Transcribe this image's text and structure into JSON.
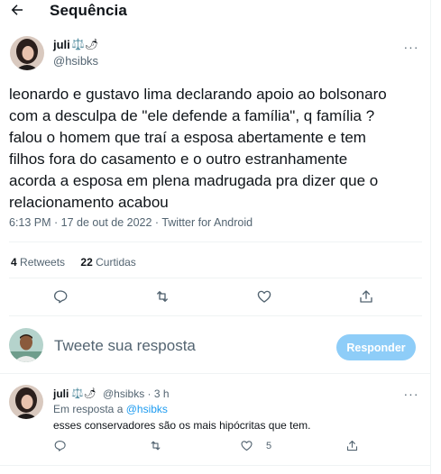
{
  "header": {
    "title": "Sequência"
  },
  "tweet": {
    "name": "juli",
    "name_emoji": "⚖️🌶",
    "handle": "@hsibks",
    "text": "leonardo e gustavo lima declarando apoio ao bolsonaro\ncom a desculpa de \"ele defende a família\", q família ?\nfalou o homem que traí a esposa abertamente e tem\nfilhos fora do casamento e o outro estranhamente\nacorda a esposa em plena madrugada pra dizer que o\nrelacionamento acabou",
    "meta": "6:13 PM · 17 de out de 2022 · Twitter for Android",
    "retweets_count": "4",
    "retweets_label": "Retweets",
    "likes_count": "22",
    "likes_label": "Curtidas"
  },
  "reply_box": {
    "placeholder": "Tweete sua resposta",
    "button_label": "Responder"
  },
  "reply": {
    "name": "juli",
    "name_emoji": "⚖️🌶",
    "handle_time": "@hsibks · 3 h",
    "replying_to_label": "Em resposta a",
    "replying_to_handle": "@hsibks",
    "text": "esses conservadores são os mais hipócritas que tem.",
    "likes": "5"
  },
  "colors": {
    "accent": "#1d9bf0",
    "button_disabled": "#8ecdf8",
    "secondary_text": "#536471"
  }
}
